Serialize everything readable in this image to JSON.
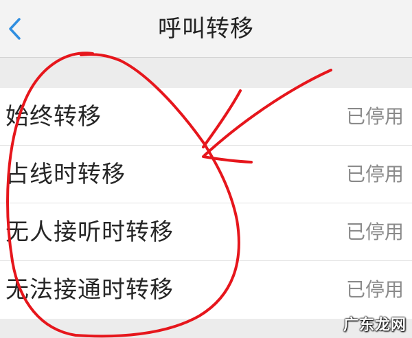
{
  "header": {
    "back_icon": "chevron-left-icon",
    "title": "呼叫转移"
  },
  "forwarding_options": [
    {
      "label": "始终转移",
      "status": "已停用"
    },
    {
      "label": "占线时转移",
      "status": "已停用"
    },
    {
      "label": "无人接听时转移",
      "status": "已停用"
    },
    {
      "label": "无法接通时转移",
      "status": "已停用"
    }
  ],
  "colors": {
    "accent": "#2f8ee0",
    "annotation": "#e6161c",
    "status_text": "#8a8a8a"
  },
  "watermark": "广东龙网"
}
